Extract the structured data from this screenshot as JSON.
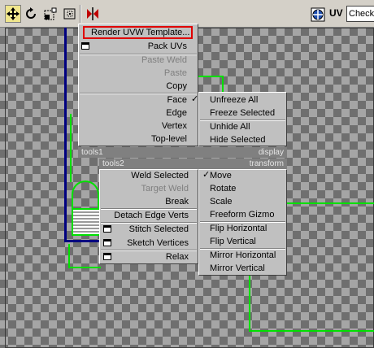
{
  "toolbar": {
    "icons": [
      "move-icon",
      "rotate-icon",
      "scale-icon",
      "freeform-icon",
      "mirror-icon"
    ],
    "uv_label": "UV",
    "checker_value": "Check"
  },
  "quad_upper_left": {
    "items": [
      {
        "label": "Render UVW Template...",
        "enabled": true,
        "highlighted": true
      },
      {
        "label": "Pack UVs",
        "enabled": true,
        "box": true
      },
      {
        "label": "Paste Weld",
        "enabled": false
      },
      {
        "label": "Paste",
        "enabled": false
      },
      {
        "label": "Copy",
        "enabled": true
      },
      {
        "label": "Face",
        "enabled": true,
        "checked": true
      },
      {
        "label": "Edge",
        "enabled": true
      },
      {
        "label": "Vertex",
        "enabled": true
      },
      {
        "label": "Top-level",
        "enabled": true
      }
    ]
  },
  "quad_upper_right": {
    "items": [
      {
        "label": "Unfreeze All"
      },
      {
        "label": "Freeze Selected"
      },
      {
        "label": "Unhide All"
      },
      {
        "label": "Hide Selected"
      }
    ]
  },
  "titles": {
    "tools1": "tools1",
    "display": "display",
    "tools2": "tools2",
    "transform": "transform"
  },
  "quad_lower_left": {
    "items": [
      {
        "label": "Weld Selected",
        "enabled": true
      },
      {
        "label": "Target Weld",
        "enabled": false
      },
      {
        "label": "Break",
        "enabled": true
      },
      {
        "label": "Detach Edge Verts",
        "enabled": true
      },
      {
        "label": "Stitch Selected",
        "enabled": true,
        "box": true
      },
      {
        "label": "Sketch Vertices",
        "enabled": true,
        "box": true
      },
      {
        "label": "Relax",
        "enabled": true,
        "box": true
      }
    ]
  },
  "quad_lower_right": {
    "items": [
      {
        "label": "Move",
        "checked": true
      },
      {
        "label": "Rotate"
      },
      {
        "label": "Scale"
      },
      {
        "label": "Freeform Gizmo"
      },
      {
        "label": "Flip Horizontal"
      },
      {
        "label": "Flip Vertical"
      },
      {
        "label": "Mirror Horizontal"
      },
      {
        "label": "Mirror Vertical"
      }
    ]
  },
  "colors": {
    "menu_bg": "#c0c0c0",
    "title_bg": "#808080",
    "highlight_border": "#e00000",
    "uv_lines": "#00e000",
    "uv_border": "#000080"
  }
}
